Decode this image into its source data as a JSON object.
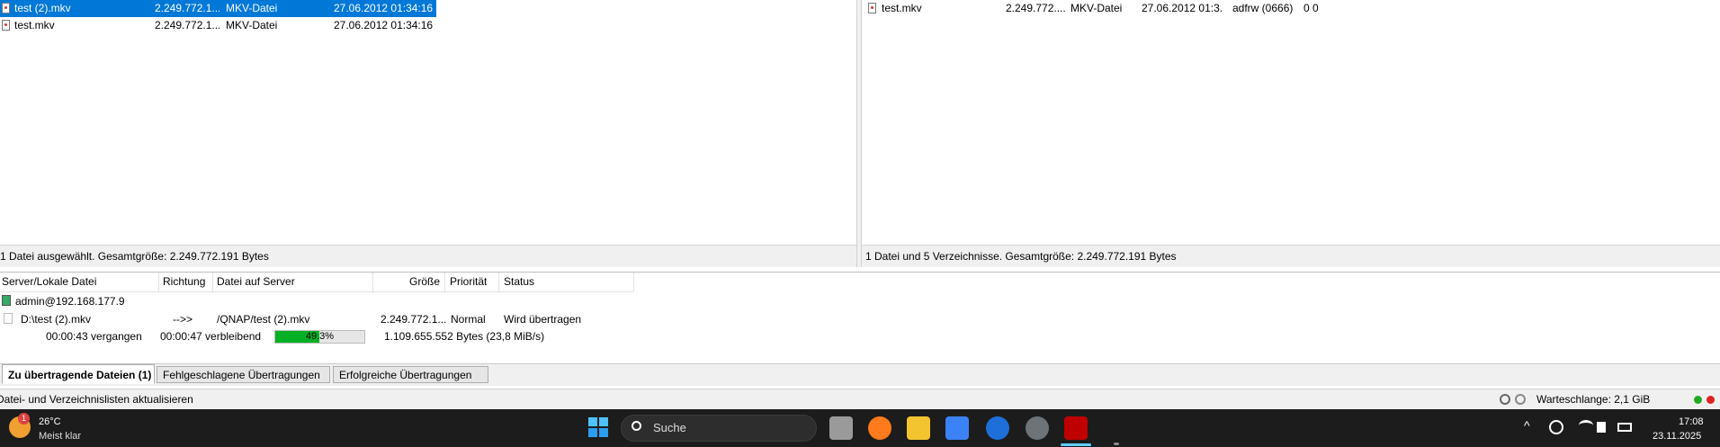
{
  "local_files": [
    {
      "name": "test (2).mkv",
      "size": "2.249.772.1...",
      "type": "MKV-Datei",
      "modified": "27.06.2012 01:34:16",
      "selected": true
    },
    {
      "name": "test.mkv",
      "size": "2.249.772.1...",
      "type": "MKV-Datei",
      "modified": "27.06.2012 01:34:16",
      "selected": false
    }
  ],
  "remote_files": [
    {
      "name": "test.mkv",
      "size": "2.249.772....",
      "type": "MKV-Datei",
      "modified": "27.06.2012 01:3...",
      "permissions": "adfrw (0666)",
      "owner": "0 0"
    }
  ],
  "local_status": "1 Datei ausgewählt. Gesamtgröße: 2.249.772.191 Bytes",
  "remote_status": "1 Datei und 5 Verzeichnisse. Gesamtgröße: 2.249.772.191 Bytes",
  "queue": {
    "columns": {
      "local": "Server/Lokale Datei",
      "direction": "Richtung",
      "remote": "Datei auf Server",
      "size": "Größe",
      "priority": "Priorität",
      "status": "Status"
    },
    "server": "admin@192.168.177.9",
    "item": {
      "local": "D:\\test (2).mkv",
      "direction": "-->>",
      "remote": "/QNAP/test (2).mkv",
      "size": "2.249.772.1...",
      "priority": "Normal",
      "status": "Wird übertragen"
    },
    "progress": {
      "elapsed": "00:00:43 vergangen",
      "remaining": "00:00:47 verbleibend",
      "percent": 49.3,
      "percent_label": "49.3%",
      "transferred": "1.109.655.552 Bytes (23,8 MiB/s)"
    }
  },
  "tabs": [
    "Zu übertragende Dateien (1)",
    "Fehlgeschlagene Übertragungen",
    "Erfolgreiche Übertragungen"
  ],
  "app_status": {
    "message": "Datei- und Verzeichnislisten aktualisieren",
    "queue": "Warteschlange: 2,1 GiB"
  },
  "taskbar": {
    "weather": {
      "temp": "26°C",
      "desc": "Meist klar",
      "badge": "1"
    },
    "search_placeholder": "Suche",
    "time": "17:08",
    "date": "23.11.2025"
  },
  "colors": {
    "selection": "#0078d7",
    "progress": "#06b025",
    "taskbar": "#1c1c1c",
    "led_green": "#22aa22",
    "led_red": "#dd2222"
  }
}
